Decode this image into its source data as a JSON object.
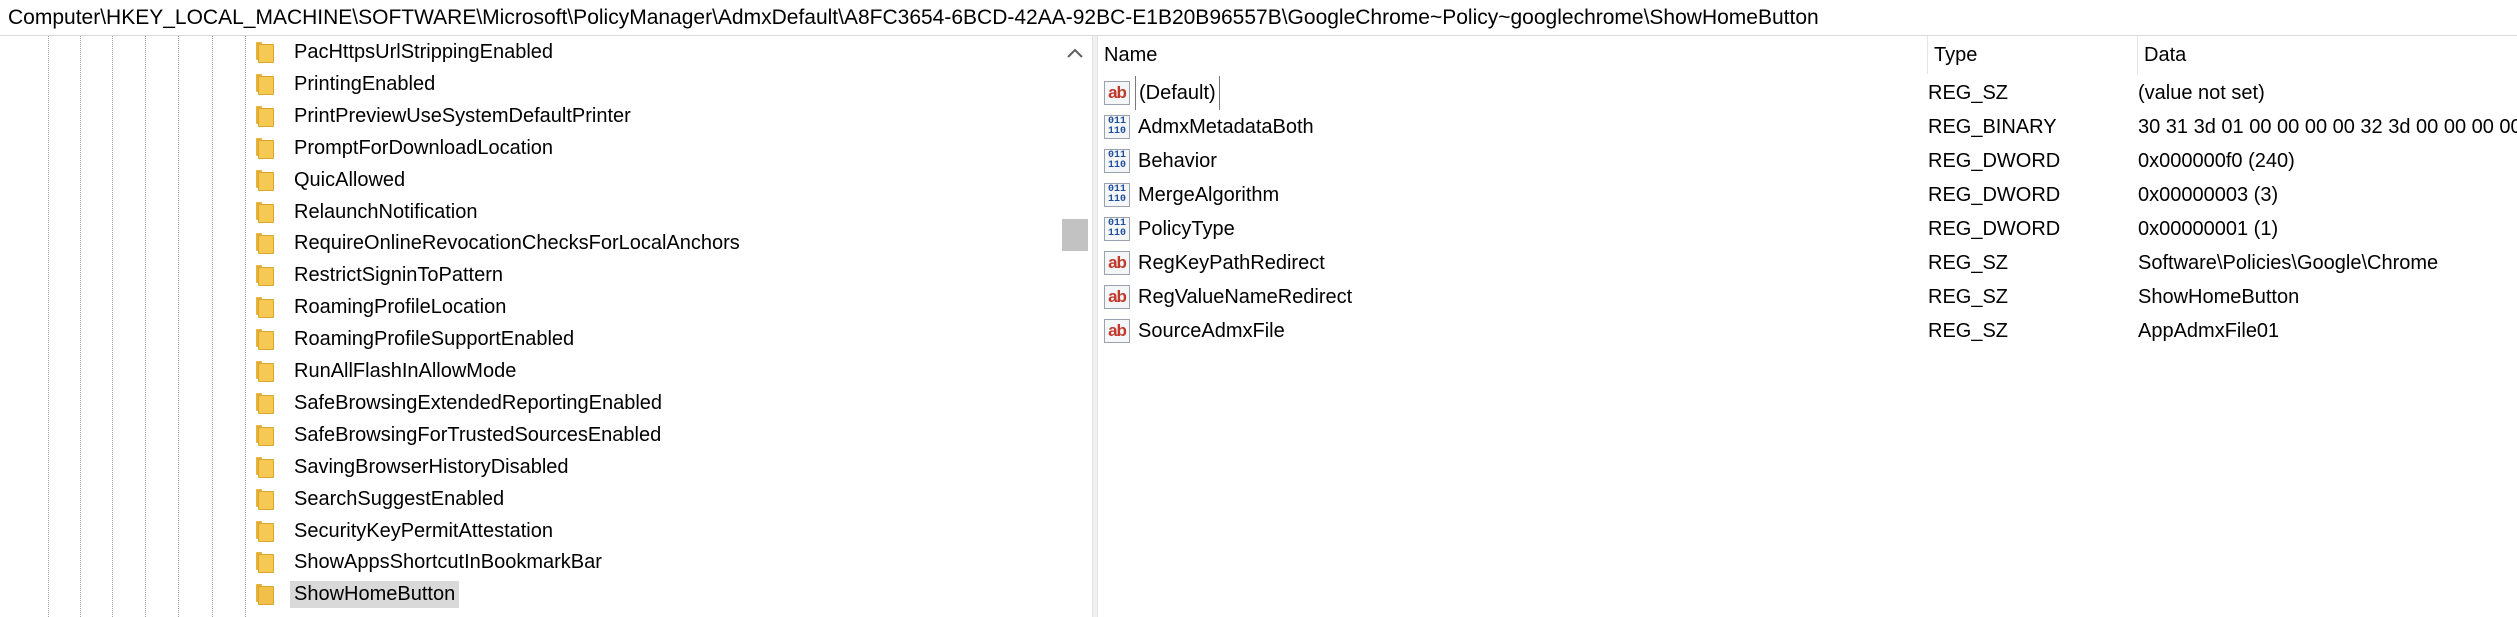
{
  "address": "Computer\\HKEY_LOCAL_MACHINE\\SOFTWARE\\Microsoft\\PolicyManager\\AdmxDefault\\A8FC3654-6BCD-42AA-92BC-E1B20B96557B\\GoogleChrome~Policy~googlechrome\\ShowHomeButton",
  "tree": {
    "items": [
      {
        "label": "PacHttpsUrlStrippingEnabled",
        "selected": false
      },
      {
        "label": "PrintingEnabled",
        "selected": false
      },
      {
        "label": "PrintPreviewUseSystemDefaultPrinter",
        "selected": false
      },
      {
        "label": "PromptForDownloadLocation",
        "selected": false
      },
      {
        "label": "QuicAllowed",
        "selected": false
      },
      {
        "label": "RelaunchNotification",
        "selected": false
      },
      {
        "label": "RequireOnlineRevocationChecksForLocalAnchors",
        "selected": false
      },
      {
        "label": "RestrictSigninToPattern",
        "selected": false
      },
      {
        "label": "RoamingProfileLocation",
        "selected": false
      },
      {
        "label": "RoamingProfileSupportEnabled",
        "selected": false
      },
      {
        "label": "RunAllFlashInAllowMode",
        "selected": false
      },
      {
        "label": "SafeBrowsingExtendedReportingEnabled",
        "selected": false
      },
      {
        "label": "SafeBrowsingForTrustedSourcesEnabled",
        "selected": false
      },
      {
        "label": "SavingBrowserHistoryDisabled",
        "selected": false
      },
      {
        "label": "SearchSuggestEnabled",
        "selected": false
      },
      {
        "label": "SecurityKeyPermitAttestation",
        "selected": false
      },
      {
        "label": "ShowAppsShortcutInBookmarkBar",
        "selected": false
      },
      {
        "label": "ShowHomeButton",
        "selected": true
      }
    ],
    "item_icon": "folder-icon",
    "scroll_up_icon": "chevron-up-icon"
  },
  "list": {
    "columns": {
      "name": "Name",
      "type": "Type",
      "data": "Data"
    },
    "rows": [
      {
        "name": "(Default)",
        "type": "REG_SZ",
        "data": "(value not set)",
        "icon": "string-value-icon",
        "focused": true
      },
      {
        "name": "AdmxMetadataBoth",
        "type": "REG_BINARY",
        "data": "30 31 3d 01 00 00 00 00 32 3d 00 00 00 00",
        "icon": "binary-value-icon",
        "focused": false
      },
      {
        "name": "Behavior",
        "type": "REG_DWORD",
        "data": "0x000000f0 (240)",
        "icon": "binary-value-icon",
        "focused": false
      },
      {
        "name": "MergeAlgorithm",
        "type": "REG_DWORD",
        "data": "0x00000003 (3)",
        "icon": "binary-value-icon",
        "focused": false
      },
      {
        "name": "PolicyType",
        "type": "REG_DWORD",
        "data": "0x00000001 (1)",
        "icon": "binary-value-icon",
        "focused": false
      },
      {
        "name": "RegKeyPathRedirect",
        "type": "REG_SZ",
        "data": "Software\\Policies\\Google\\Chrome",
        "icon": "string-value-icon",
        "focused": false
      },
      {
        "name": "RegValueNameRedirect",
        "type": "REG_SZ",
        "data": "ShowHomeButton",
        "icon": "string-value-icon",
        "focused": false
      },
      {
        "name": "SourceAdmxFile",
        "type": "REG_SZ",
        "data": "AppAdmxFile01",
        "icon": "string-value-icon",
        "focused": false
      }
    ]
  },
  "icons": {
    "string_glyph": "ab",
    "binary_glyph": "011\n110"
  },
  "colors": {
    "selection": "#d9d9d9",
    "folder": "#f6c954",
    "string_icon": "#c0392b",
    "binary_icon": "#1f4e9c"
  }
}
